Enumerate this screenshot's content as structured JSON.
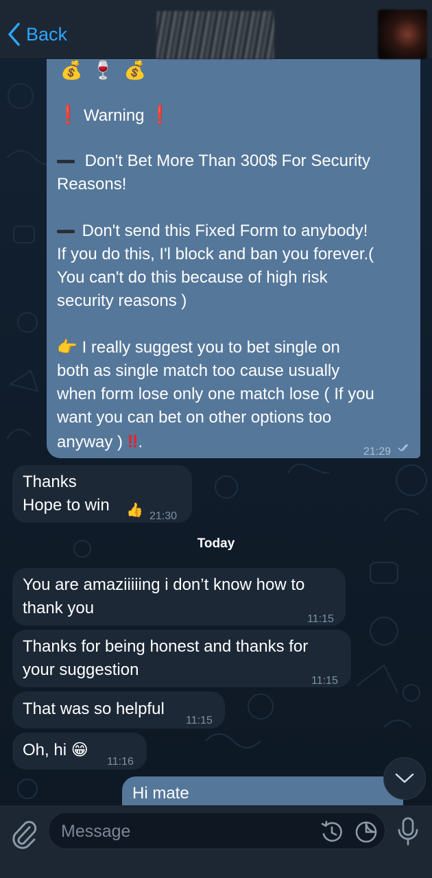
{
  "header": {
    "back_label": "Back"
  },
  "messages": {
    "big": {
      "emojis": [
        "💰",
        "🍷",
        "💰"
      ],
      "warning_label": "Warning",
      "line1a": "Don't Bet More Than 300$ For Security",
      "line1b": "Reasons!",
      "line2a": "Don't send this Fixed Form to anybody!",
      "line2b": "If you do this, I'l block and ban you forever.(",
      "line2c": "You can't do this because of high risk",
      "line2d": "security reasons )",
      "line3a": "I really suggest you to bet single on",
      "line3b": "both as single match too cause usually",
      "line3c": "when form lose only one match lose ( If you",
      "line3d": "want you can bet on other options too",
      "line3e": "anyway )",
      "time": "21:29"
    },
    "thanks": {
      "line1": "Thanks",
      "line2": "Hope to win",
      "emoji": "👍",
      "time": "21:30"
    },
    "date_separator": "Today",
    "m1": {
      "line1": "You are amaziiiiing i don’t know how to",
      "line2": "thank you",
      "time": "11:15"
    },
    "m2": {
      "line1": "Thanks for being honest and thanks for",
      "line2": "your suggestion",
      "time": "11:15"
    },
    "m3": {
      "text": "That was so helpful",
      "time": "11:15"
    },
    "m4": {
      "text": "Oh, hi",
      "emoji": "😁",
      "time": "11:16"
    },
    "m5": {
      "text": "Hi mate"
    }
  },
  "composer": {
    "placeholder": "Message"
  },
  "colors": {
    "accent": "#2ea6ff",
    "outgoing_bubble": "#55779a",
    "incoming_bubble": "#1c2836",
    "warning_red": "#e8202d"
  }
}
